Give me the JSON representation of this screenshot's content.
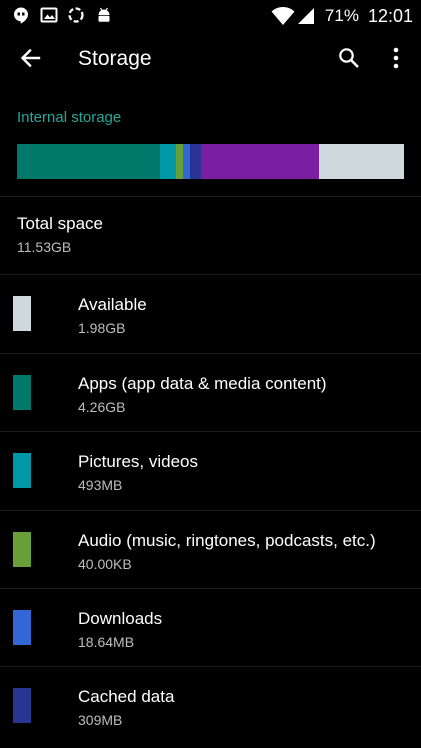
{
  "status_bar": {
    "battery": "71%",
    "time": "12:01",
    "left_icons": [
      "hangouts-icon",
      "gallery-icon",
      "oneplus-icon",
      "android-icon"
    ],
    "right_icons": [
      "wifi-icon",
      "signal-icon"
    ]
  },
  "toolbar": {
    "title": "Storage",
    "back_icon": "arrow-back-icon",
    "search_icon": "search-icon",
    "more_icon": "more-vert-icon"
  },
  "section": {
    "title": "Internal storage"
  },
  "bar": {
    "segments": [
      {
        "name": "apps",
        "color": "#00796b",
        "fraction": 0.37
      },
      {
        "name": "pictures",
        "color": "#0097a7",
        "fraction": 0.042
      },
      {
        "name": "audio",
        "color": "#689f38",
        "fraction": 0.018
      },
      {
        "name": "downloads",
        "color": "#3367d6",
        "fraction": 0.018
      },
      {
        "name": "cached",
        "color": "#283593",
        "fraction": 0.027
      },
      {
        "name": "misc",
        "color": "#7b1fa2",
        "fraction": 0.305
      },
      {
        "name": "available",
        "color": "#cfd8dc",
        "fraction": 0.22
      }
    ]
  },
  "total": {
    "title": "Total space",
    "value": "11.53GB"
  },
  "items": [
    {
      "title": "Available",
      "value": "1.98GB",
      "color": "#cfd8dc"
    },
    {
      "title": "Apps (app data & media content)",
      "value": "4.26GB",
      "color": "#00796b"
    },
    {
      "title": "Pictures, videos",
      "value": "493MB",
      "color": "#0097a7"
    },
    {
      "title": "Audio (music, ringtones, podcasts, etc.)",
      "value": "40.00KB",
      "color": "#689f38"
    },
    {
      "title": "Downloads",
      "value": "18.64MB",
      "color": "#3367d6"
    },
    {
      "title": "Cached data",
      "value": "309MB",
      "color": "#283593"
    }
  ]
}
